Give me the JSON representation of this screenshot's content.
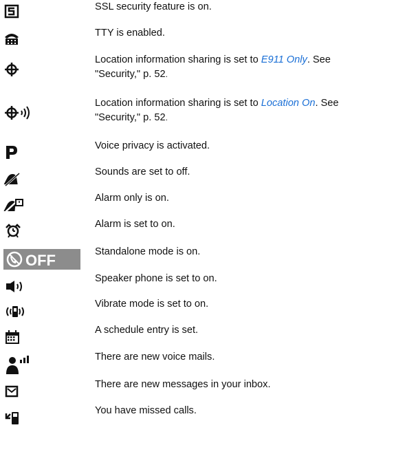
{
  "entries": [
    {
      "icon": "ssl-icon",
      "text": "SSL security feature is on."
    },
    {
      "icon": "tty-icon",
      "text": "TTY is enabled."
    },
    {
      "icon": "location-e911-icon",
      "pre": "Location information sharing is set to ",
      "link": "E911 Only",
      "mid": ". See",
      "ref": "\"Security,\" p. 52",
      "end": "."
    },
    {
      "icon": "location-on-icon",
      "pre": "Location information sharing is set to ",
      "link": "Location On",
      "mid": ". See",
      "ref": "\"Security,\" p. 52",
      "end": "."
    },
    {
      "icon": "voice-privacy-icon",
      "text": "Voice privacy is activated."
    },
    {
      "icon": "sounds-off-icon",
      "text": "Sounds are set to off."
    },
    {
      "icon": "alarm-only-icon",
      "text": "Alarm only is on."
    },
    {
      "icon": "alarm-on-icon",
      "text": "Alarm is set to on."
    },
    {
      "icon": "standalone-off-icon",
      "badge": "OFF",
      "text": "Standalone mode is on."
    },
    {
      "icon": "speaker-phone-icon",
      "text": "Speaker phone is set to on."
    },
    {
      "icon": "vibrate-icon",
      "text": "Vibrate mode is set to on."
    },
    {
      "icon": "calendar-icon",
      "text": "A schedule entry is set."
    },
    {
      "icon": "voice-mail-icon",
      "text": "There are new voice mails."
    },
    {
      "icon": "message-icon",
      "text": "There are new messages in your inbox."
    },
    {
      "icon": "missed-calls-icon",
      "text": "You have missed calls."
    }
  ],
  "colors": {
    "link": "#1a6fd6",
    "icon": "#111111",
    "badge_bg": "#8c8c8c"
  }
}
